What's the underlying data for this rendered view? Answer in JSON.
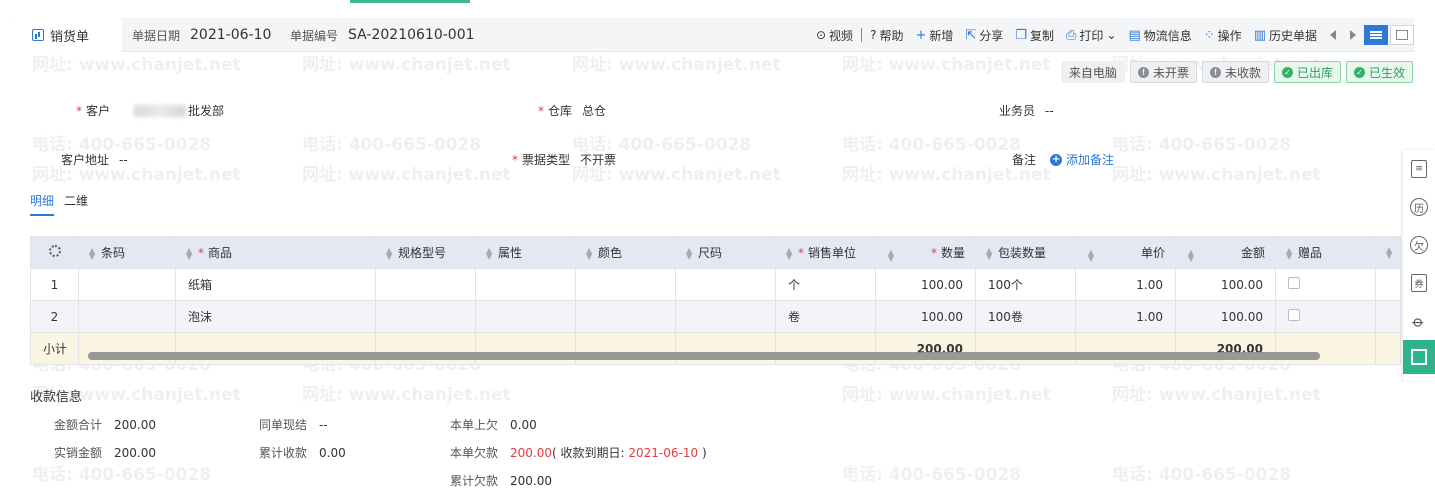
{
  "header": {
    "tab_label": "销货单",
    "date_label": "单据日期",
    "date_value": "2021-06-10",
    "code_label": "单据编号",
    "code_value": "SA-20210610-001"
  },
  "toolbar": {
    "video": "视频",
    "help": "帮助",
    "new": "新增",
    "share": "分享",
    "copy": "复制",
    "print": "打印",
    "logistics": "物流信息",
    "operate": "操作",
    "history": "历史单据"
  },
  "status": {
    "source": "来自电脑",
    "invoice": "未开票",
    "payment": "未收款",
    "outbound": "已出库",
    "effective": "已生效"
  },
  "form": {
    "customer_label": "客户",
    "customer_value": "批发部",
    "warehouse_label": "仓库",
    "warehouse_value": "总仓",
    "salesman_label": "业务员",
    "salesman_value": "--",
    "address_label": "客户地址",
    "address_value": "--",
    "bill_type_label": "票据类型",
    "bill_type_value": "不开票",
    "note_label": "备注",
    "add_note": "添加备注"
  },
  "subtabs": [
    "明细",
    "二维"
  ],
  "table": {
    "headers": [
      "条码",
      "商品",
      "规格型号",
      "属性",
      "颜色",
      "尺码",
      "销售单位",
      "数量",
      "包装数量",
      "单价",
      "金额",
      "赠品"
    ],
    "rows": [
      {
        "idx": "1",
        "barcode": "",
        "product": "纸箱",
        "spec": "",
        "attr": "",
        "color": "",
        "size": "",
        "unit": "个",
        "qty": "100.00",
        "pack": "100个",
        "price": "1.00",
        "amount": "100.00"
      },
      {
        "idx": "2",
        "barcode": "",
        "product": "泡沫",
        "spec": "",
        "attr": "",
        "color": "",
        "size": "",
        "unit": "卷",
        "qty": "100.00",
        "pack": "100卷",
        "price": "1.00",
        "amount": "100.00"
      }
    ],
    "subtotal_label": "小计",
    "subtotal_qty": "200.00",
    "subtotal_amount": "200.00"
  },
  "payment": {
    "title": "收款信息",
    "total_label": "金额合计",
    "total_value": "200.00",
    "actual_label": "实销金额",
    "actual_value": "200.00",
    "cash_label": "同单现结",
    "cash_value": "--",
    "received_label": "累计收款",
    "received_value": "0.00",
    "prev_owed_label": "本单上欠",
    "prev_owed_value": "0.00",
    "owed_label": "本单欠款",
    "owed_value": "200.00",
    "due_prefix": "( 收款到期日: ",
    "due_date": "2021-06-10",
    "due_suffix": " )",
    "cumulative_label": "累计欠款",
    "cumulative_value": "200.00"
  },
  "sidebar": {
    "history": "历",
    "owe": "欠",
    "coupon": "券"
  },
  "watermark": {
    "phone": "电话: 400-665-0028",
    "site": "网址: www.chanjet.net"
  }
}
